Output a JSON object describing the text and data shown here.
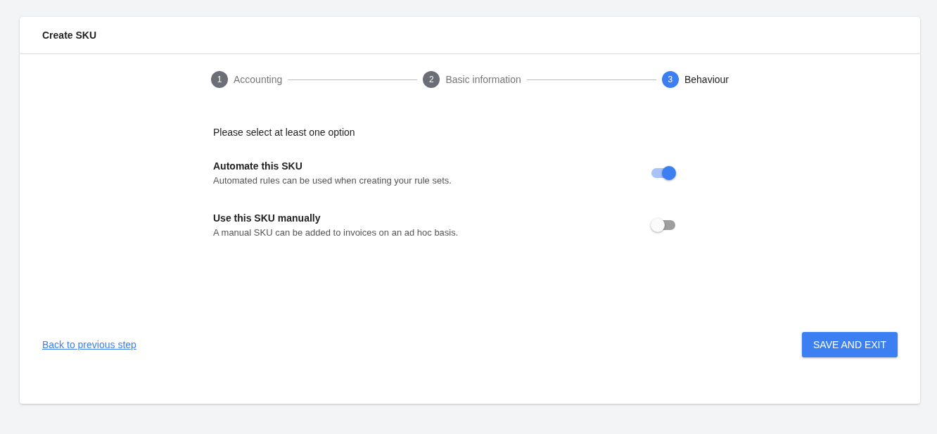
{
  "card": {
    "title": "Create SKU"
  },
  "steps": [
    {
      "number": "1",
      "label": "Accounting",
      "selected": false
    },
    {
      "number": "2",
      "label": "Basic information",
      "selected": false
    },
    {
      "number": "3",
      "label": "Behaviour",
      "selected": true
    }
  ],
  "prompt": "Please select at least one option",
  "options": [
    {
      "title": "Automate this SKU",
      "description": "Automated rules can be used when creating your rule sets.",
      "on": true
    },
    {
      "title": "Use this SKU manually",
      "description": "A manual SKU can be added to invoices on an ad hoc basis.",
      "on": false
    }
  ],
  "back_link": "Back to previous step",
  "save_button": "SAVE AND EXIT"
}
